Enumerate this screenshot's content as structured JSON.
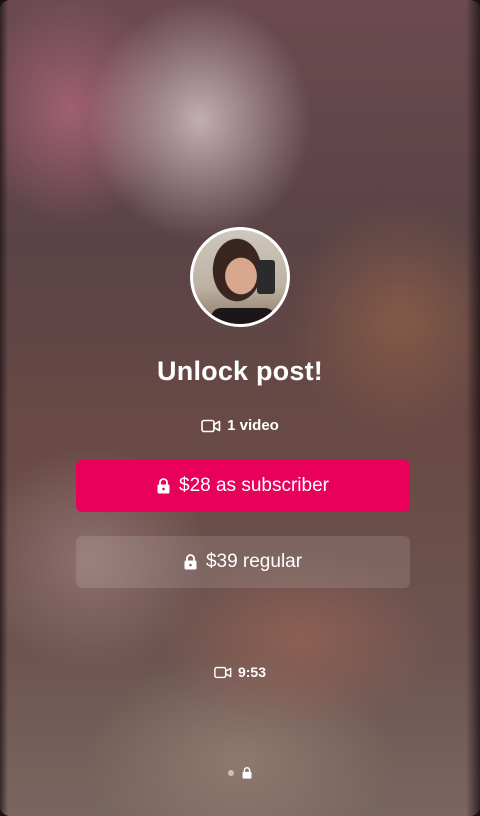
{
  "post": {
    "title": "Unlock post!",
    "media_count_label": "1 video",
    "duration": "9:53"
  },
  "buttons": {
    "subscriber_label": "$28 as subscriber",
    "regular_label": "$39 regular"
  },
  "icons": {
    "video": "video-camera-icon",
    "lock": "lock-icon"
  },
  "carousel": {
    "pages": 2,
    "current": 1
  },
  "colors": {
    "primary": "#e8005a"
  }
}
